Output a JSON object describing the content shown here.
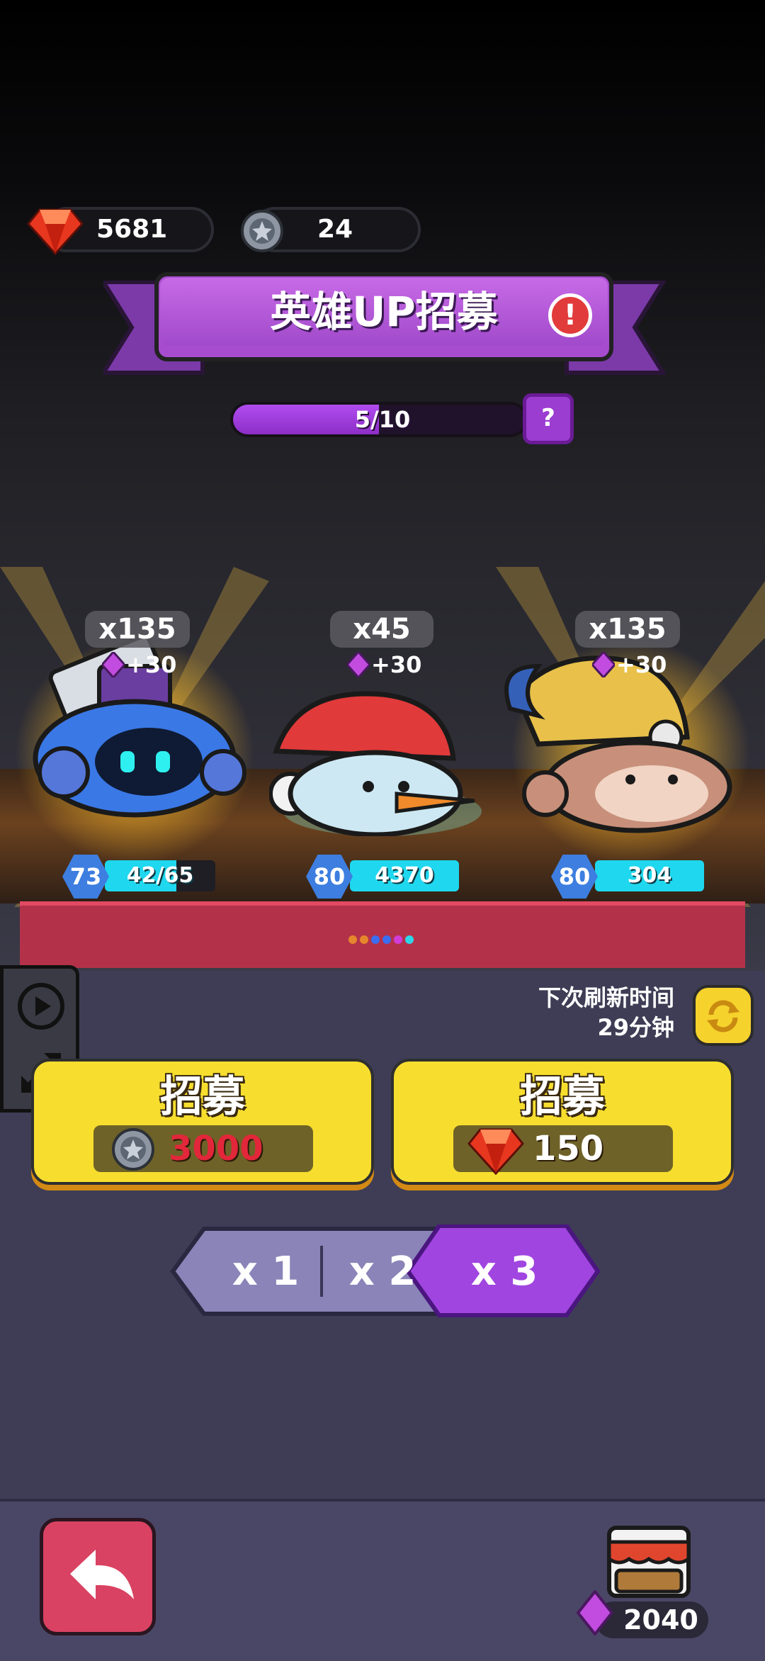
{
  "currencies": {
    "ruby": {
      "value": "5681",
      "icon": "ruby-gem-icon"
    },
    "silver_coin": {
      "value": "24",
      "icon": "star-coin-icon"
    }
  },
  "banner": {
    "title": "英雄UP招募",
    "alert_icon": "exclamation-icon",
    "alert_symbol": "!"
  },
  "progress": {
    "text": "5/10",
    "fraction": 0.5,
    "help_symbol": "?"
  },
  "heroes": [
    {
      "name_icon": "blue-robot-hero",
      "count": "x135",
      "gem_bonus": "+30",
      "level": "73",
      "stat": "42/65",
      "stat_fraction": 0.65
    },
    {
      "name_icon": "snowman-hero",
      "count": "x45",
      "gem_bonus": "+30",
      "level": "80",
      "stat": "4370",
      "stat_fraction": 1.0
    },
    {
      "name_icon": "monkey-hero",
      "count": "x135",
      "gem_bonus": "+30",
      "level": "80",
      "stat": "304",
      "stat_fraction": 1.0
    }
  ],
  "carousel_dots": [
    "#e6862c",
    "#e6862c",
    "#3b6df0",
    "#3b6df0",
    "#d23cd8",
    "#2fd6e8"
  ],
  "refresh": {
    "label": "下次刷新时间",
    "time": "29分钟",
    "icon": "refresh-icon"
  },
  "recruit_buttons": [
    {
      "label": "招募",
      "cost": "3000",
      "cost_icon": "star-coin-icon",
      "cost_color": "#e2273a"
    },
    {
      "label": "招募",
      "cost": "150",
      "cost_icon": "ruby-gem-icon",
      "cost_color": "#ffffff"
    }
  ],
  "multiplier": {
    "options": [
      "x 1",
      "x 2",
      "x 3"
    ],
    "selected": "x 3"
  },
  "footer": {
    "back_icon": "back-arrow-icon",
    "shop_icon": "shop-stall-icon",
    "shop_gem_value": "2040"
  },
  "colors": {
    "accent_purple": "#a84ccf",
    "button_yellow": "#f7de2e",
    "stat_cyan": "#1fd7ee",
    "back_red": "#d94262"
  }
}
